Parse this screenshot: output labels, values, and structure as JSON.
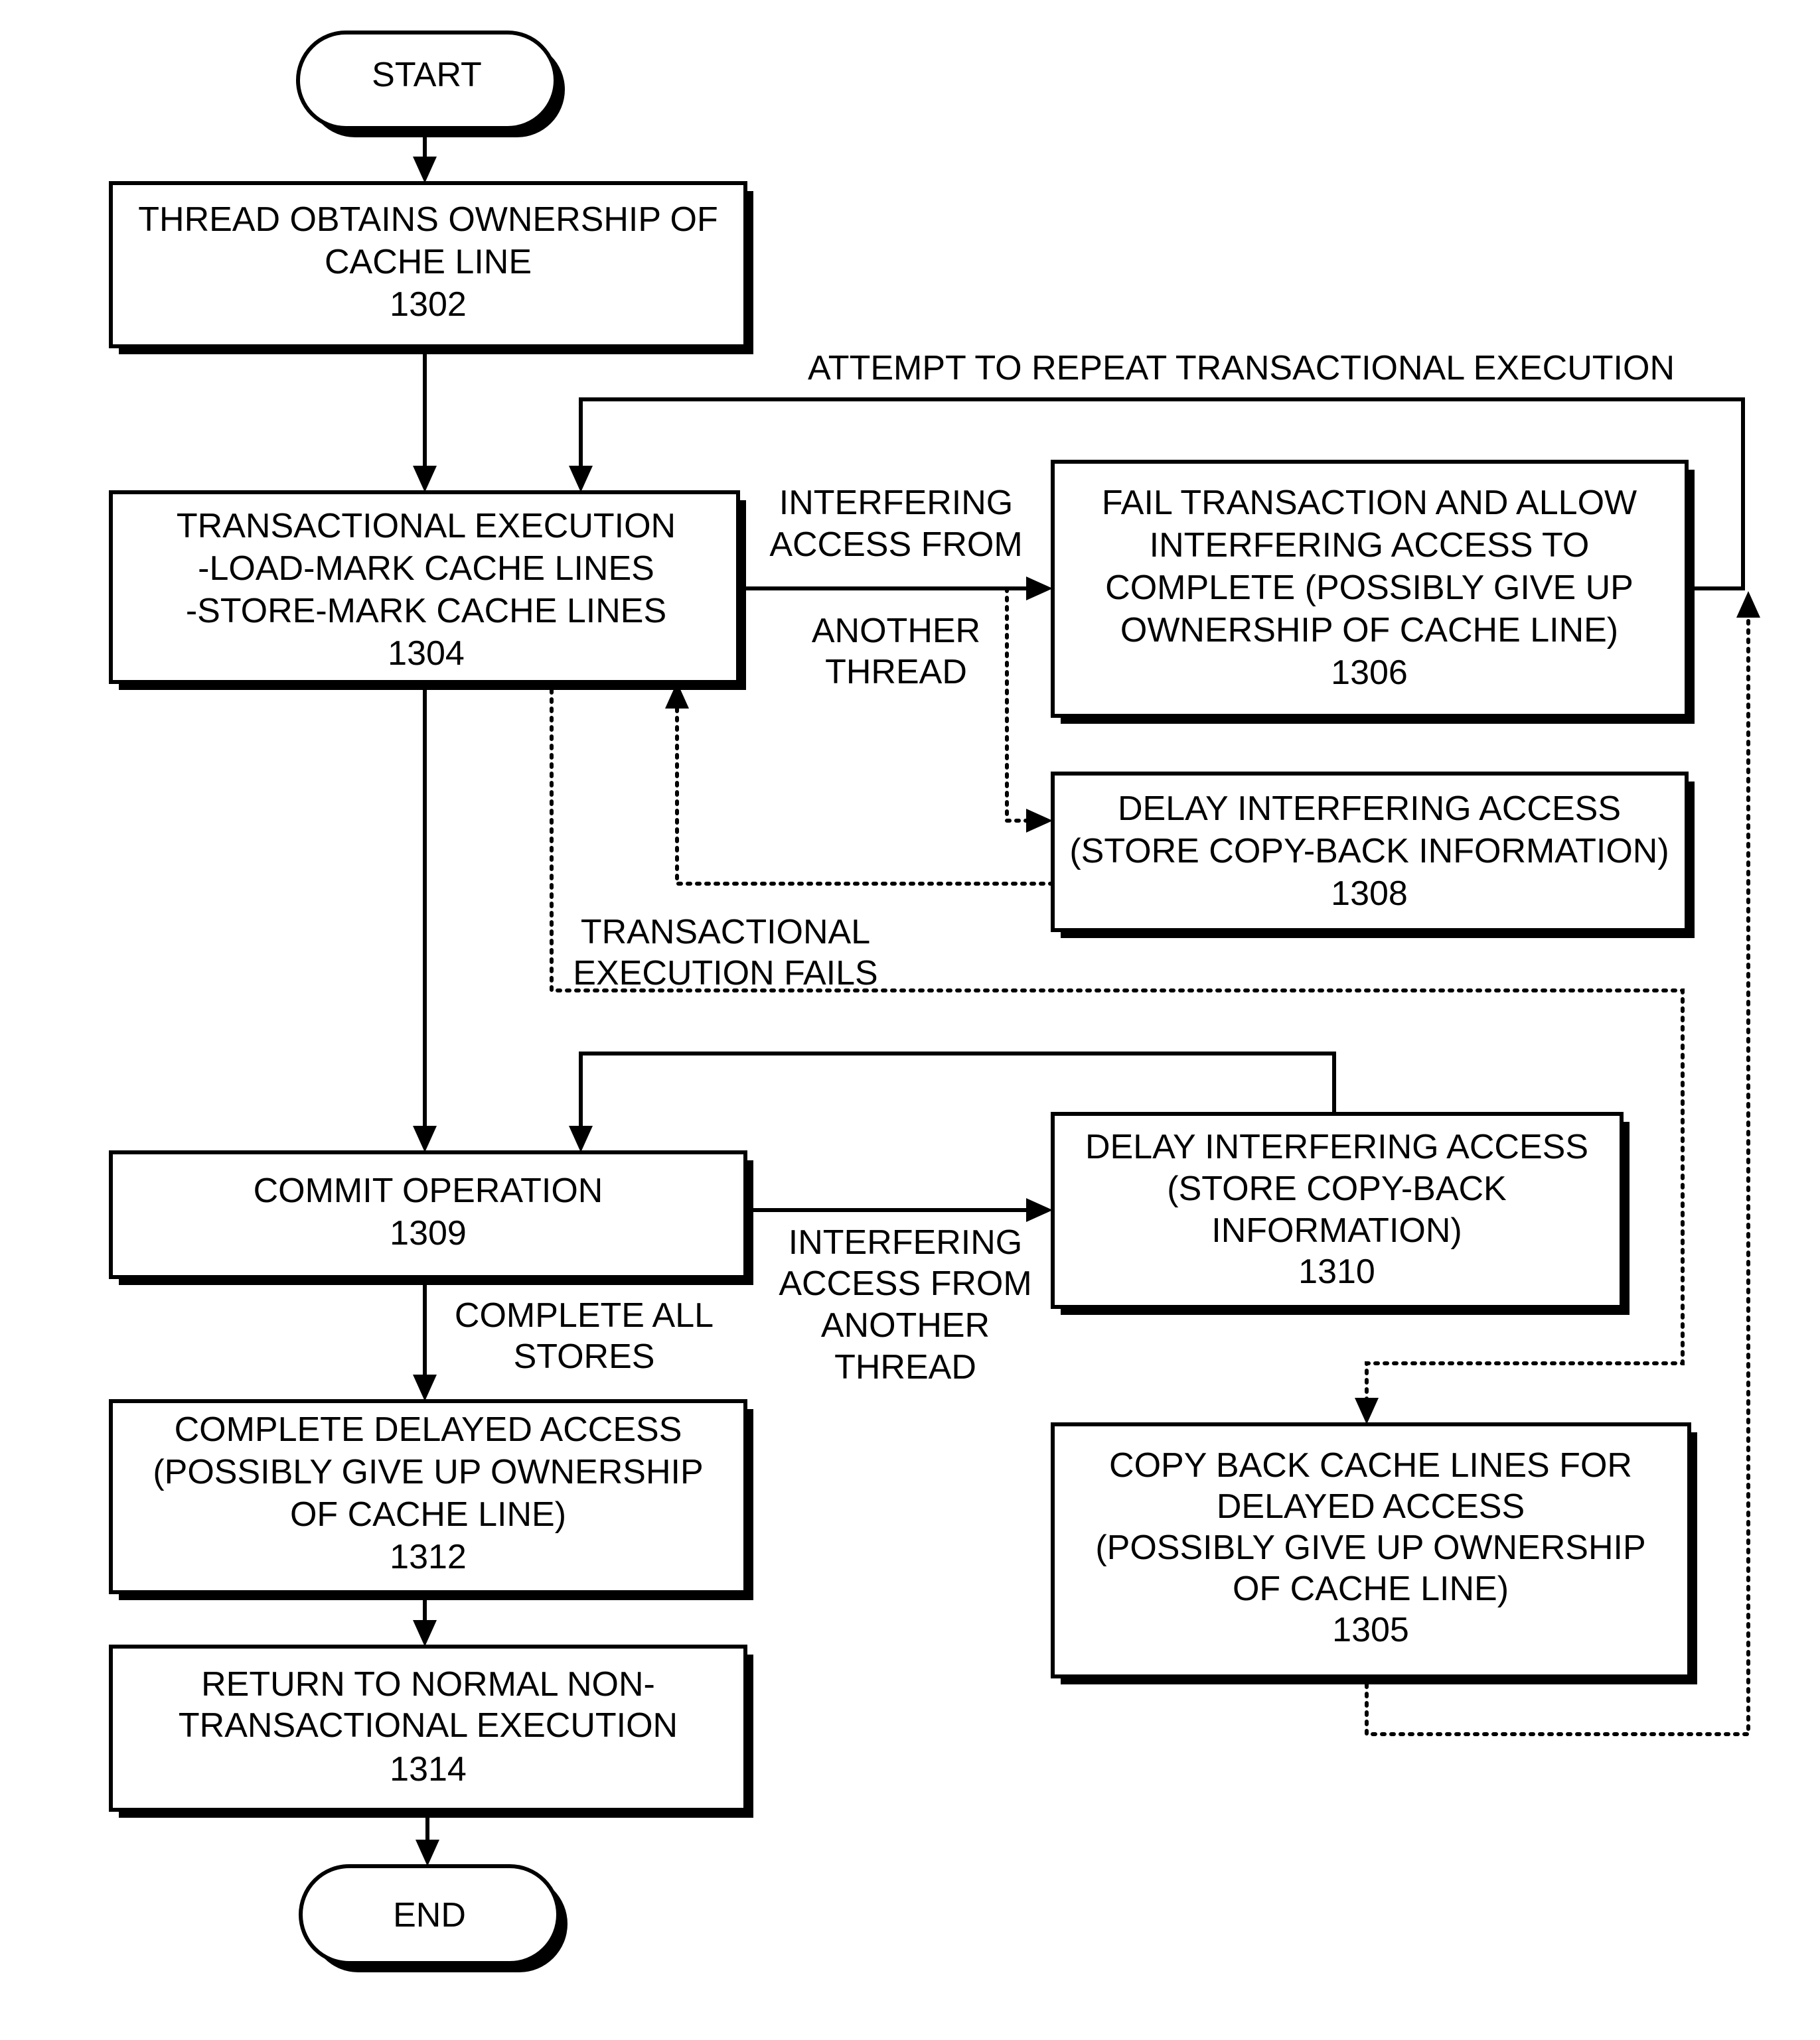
{
  "figure": {
    "terminals": {
      "start": "START",
      "end": "END"
    },
    "steps": {
      "s1302": {
        "lines": [
          "THREAD OBTAINS OWNERSHIP OF",
          "CACHE LINE",
          "1302"
        ]
      },
      "s1304": {
        "lines": [
          "TRANSACTIONAL EXECUTION",
          "-LOAD-MARK CACHE LINES",
          "-STORE-MARK CACHE LINES",
          "1304"
        ]
      },
      "s1306": {
        "lines": [
          "FAIL TRANSACTION AND ALLOW",
          "INTERFERING ACCESS TO",
          "COMPLETE (POSSIBLY GIVE UP",
          "OWNERSHIP OF CACHE LINE)",
          "1306"
        ]
      },
      "s1308": {
        "lines": [
          "DELAY INTERFERING ACCESS",
          "(STORE COPY-BACK INFORMATION)",
          "1308"
        ]
      },
      "s1309": {
        "lines": [
          "COMMIT OPERATION",
          "1309"
        ]
      },
      "s1310": {
        "lines": [
          "DELAY INTERFERING ACCESS",
          "(STORE COPY-BACK",
          "INFORMATION)",
          "1310"
        ]
      },
      "s1312": {
        "lines": [
          "COMPLETE DELAYED ACCESS",
          "(POSSIBLY GIVE UP OWNERSHIP",
          "OF CACHE LINE)",
          "1312"
        ]
      },
      "s1314": {
        "lines": [
          "RETURN TO NORMAL NON-",
          "TRANSACTIONAL EXECUTION",
          "1314"
        ]
      },
      "s1305": {
        "lines": [
          "COPY BACK CACHE LINES FOR",
          "DELAYED ACCESS",
          "(POSSIBLY GIVE UP OWNERSHIP",
          "OF CACHE LINE)",
          "1305"
        ]
      }
    },
    "edge_labels": {
      "repeat": "ATTEMPT TO REPEAT TRANSACTIONAL EXECUTION",
      "interfering_top": [
        "INTERFERING",
        "ACCESS FROM"
      ],
      "interfering_bottom": [
        "ANOTHER",
        "THREAD"
      ],
      "tx_fails": [
        "TRANSACTIONAL",
        "EXECUTION FAILS"
      ],
      "complete_stores": [
        "COMPLETE ALL",
        "STORES"
      ],
      "interfering_commit": [
        "INTERFERING",
        "ACCESS FROM",
        "ANOTHER",
        "THREAD"
      ]
    }
  }
}
